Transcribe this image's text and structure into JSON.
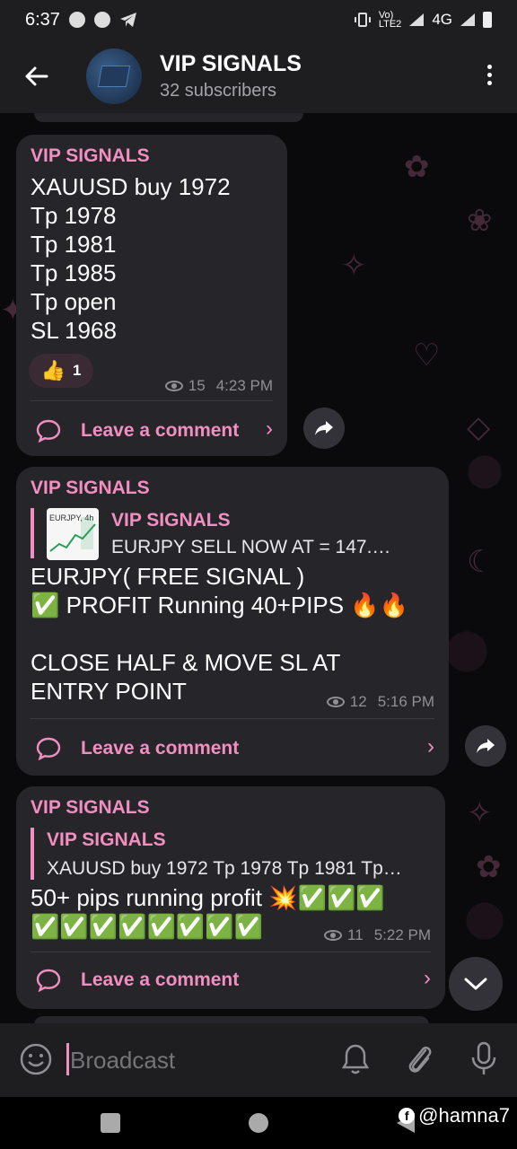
{
  "status_bar": {
    "time": "6:37",
    "network": "4G"
  },
  "header": {
    "title": "VIP SIGNALS",
    "subtitle": "32 subscribers"
  },
  "messages": [
    {
      "sender": "VIP SIGNALS",
      "text": "XAUUSD buy 1972\nTp 1978\nTp 1981\nTp 1985\nTp open\nSL 1968",
      "reaction_emoji": "👍",
      "reaction_count": "1",
      "views": "15",
      "time": "4:23 PM",
      "comment_label": "Leave a comment"
    },
    {
      "sender": "VIP SIGNALS",
      "quote_title": "VIP SIGNALS",
      "quote_text": "EURJPY  SELL  NOW  AT = 147.…",
      "thumb_text": "EURJPY, 4h",
      "text": "EURJPY( FREE SIGNAL )\n✅ PROFIT Running 40+PIPS 🔥🔥\n\nCLOSE HALF & MOVE SL AT\nENTRY POINT",
      "views": "12",
      "time": "5:16 PM",
      "comment_label": "Leave a comment"
    },
    {
      "sender": "VIP SIGNALS",
      "quote_title": "VIP SIGNALS",
      "quote_text": "XAUUSD buy 1972 Tp 1978 Tp 1981 Tp…",
      "text": "50+ pips running profit 💥✅✅✅\n✅✅✅✅✅✅✅✅",
      "views": "11",
      "time": "5:22 PM",
      "comment_label": "Leave a comment"
    }
  ],
  "input": {
    "placeholder": "Broadcast"
  },
  "watermark": "@hamna7"
}
